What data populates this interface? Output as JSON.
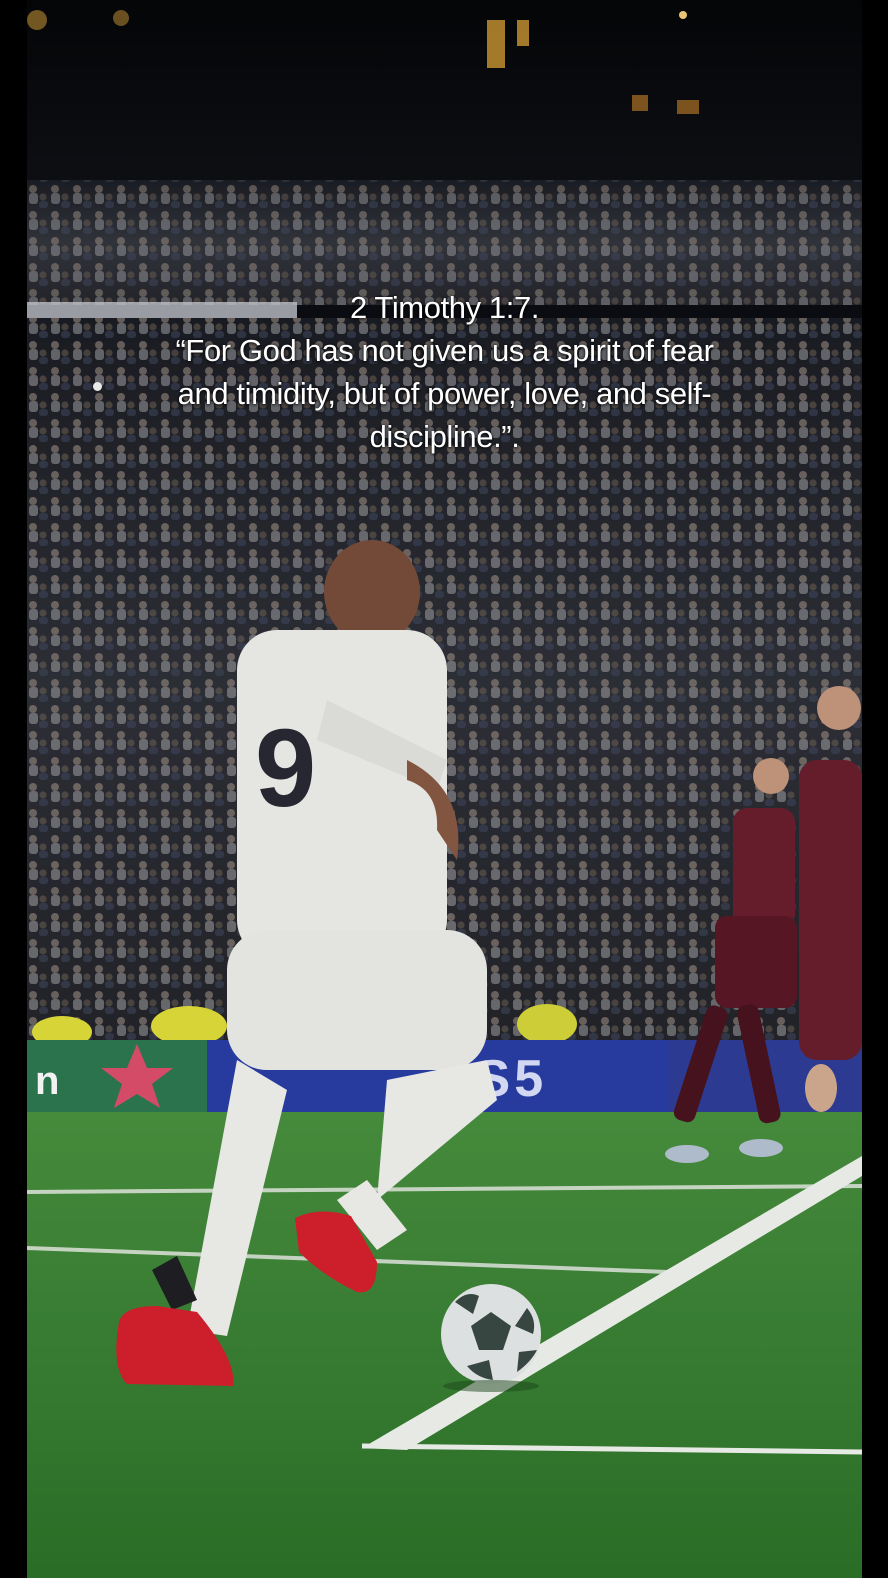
{
  "caption": {
    "reference": "2 Timothy 1:7.",
    "line_1": "“For God has not given us a spirit of fear",
    "line_2": "and timidity, but of power, love, and self-",
    "line_3": "discipline.”."
  },
  "scene": {
    "player_number": "9",
    "ad_board_text": "PS5",
    "colors": {
      "pitch": "#3f8a3a",
      "crowd": "#2a2c33",
      "home_kit": "#f2f2ef",
      "away_kit": "#6b1f2e",
      "boots": "#d8202e",
      "ad_board": "#2a3fa8"
    }
  }
}
